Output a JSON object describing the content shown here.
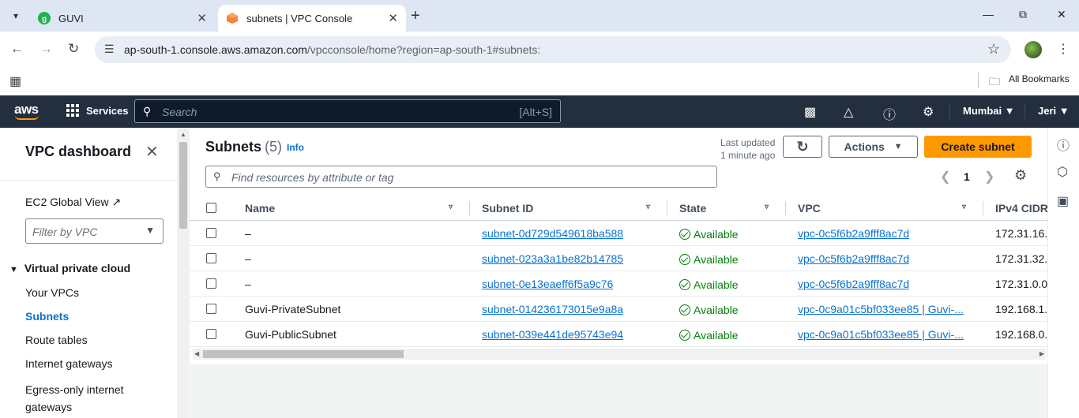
{
  "browser": {
    "tabs": [
      {
        "title": "GUVI",
        "favicon": "guvi-icon"
      },
      {
        "title": "subnets | VPC Console",
        "favicon": "aws-cube-icon"
      }
    ],
    "url_host": "ap-south-1.console.aws.amazon.com",
    "url_path": "/vpcconsole/home?region=ap-south-1#subnets:",
    "bookmarks_label": "All Bookmarks"
  },
  "aws": {
    "logo": "aws",
    "services_label": "Services",
    "search_placeholder": "Search",
    "search_shortcut": "[Alt+S]",
    "region": "Mumbai",
    "user": "Jeri",
    "accent": "#ff9900",
    "header_bg": "#232f3e"
  },
  "sidenav": {
    "title": "VPC dashboard",
    "ec2_global_view": "EC2 Global View",
    "filter_placeholder": "Filter by VPC",
    "section": "Virtual private cloud",
    "items": [
      "Your VPCs",
      "Subnets",
      "Route tables",
      "Internet gateways",
      "Egress-only internet gateways"
    ],
    "active_item": "Subnets"
  },
  "page": {
    "title": "Subnets",
    "count": "(5)",
    "info": "Info",
    "last_updated_line1": "Last updated",
    "last_updated_line2": "1 minute ago",
    "actions_label": "Actions",
    "create_label": "Create subnet",
    "filter_placeholder": "Find resources by attribute or tag",
    "page_number": "1"
  },
  "table": {
    "columns": [
      "Name",
      "Subnet ID",
      "State",
      "VPC",
      "IPv4 CIDR"
    ],
    "rows": [
      {
        "name": "–",
        "subnet_id": "subnet-0d729d549618ba588",
        "state": "Available",
        "vpc": "vpc-0c5f6b2a9fff8ac7d",
        "cidr": "172.31.16."
      },
      {
        "name": "–",
        "subnet_id": "subnet-023a3a1be82b14785",
        "state": "Available",
        "vpc": "vpc-0c5f6b2a9fff8ac7d",
        "cidr": "172.31.32."
      },
      {
        "name": "–",
        "subnet_id": "subnet-0e13eaeff6f5a9c76",
        "state": "Available",
        "vpc": "vpc-0c5f6b2a9fff8ac7d",
        "cidr": "172.31.0.0"
      },
      {
        "name": "Guvi-PrivateSubnet",
        "subnet_id": "subnet-014236173015e9a8a",
        "state": "Available",
        "vpc": "vpc-0c9a01c5bf033ee85 | Guvi-...",
        "cidr": "192.168.1."
      },
      {
        "name": "Guvi-PublicSubnet",
        "subnet_id": "subnet-039e441de95743e94",
        "state": "Available",
        "vpc": "vpc-0c9a01c5bf033ee85 | Guvi-...",
        "cidr": "192.168.0."
      }
    ]
  }
}
